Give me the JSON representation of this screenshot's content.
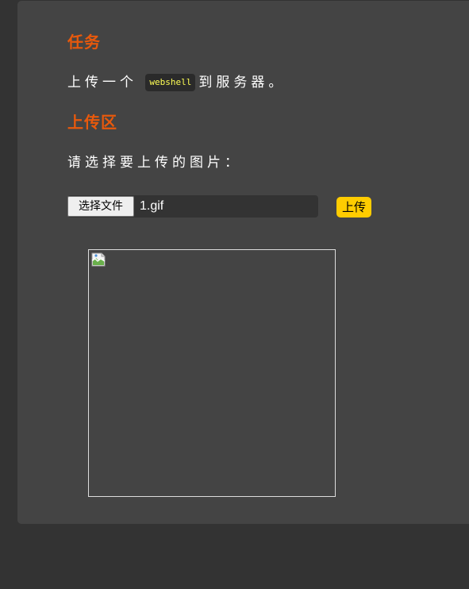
{
  "task": {
    "heading": "任务",
    "text_before": "上传一个",
    "code": "webshell",
    "text_after": "到服务器。"
  },
  "upload": {
    "heading": "上传区",
    "prompt": "请选择要上传的图片：",
    "choose_file_label": "选择文件",
    "file_name": "1.gif",
    "submit_label": "上传"
  },
  "preview": {
    "icon": "broken-image-icon"
  },
  "colors": {
    "heading": "#e8590c",
    "submit_button": "#ffcc00",
    "code_text": "#ffff55",
    "panel": "#444444",
    "background": "#333333"
  }
}
